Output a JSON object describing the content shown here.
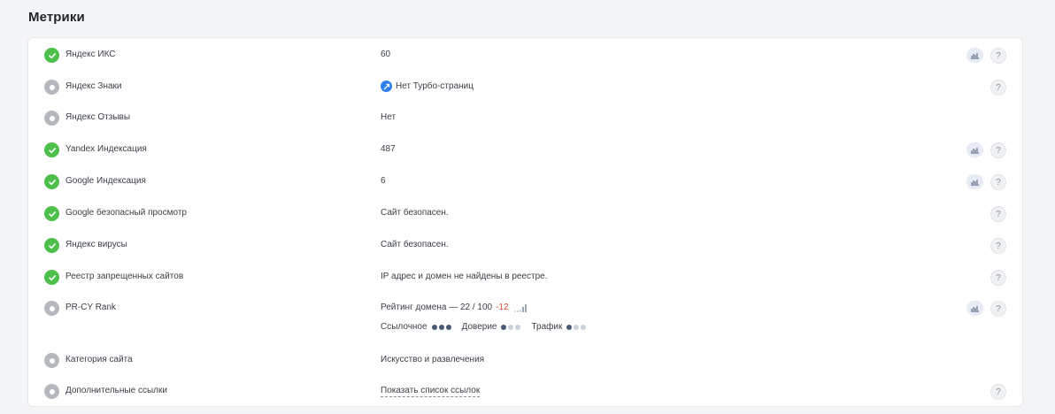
{
  "section_title": "Метрики",
  "rows": [
    {
      "label": "Яндекс ИКС",
      "value": "60"
    },
    {
      "label": "Яндекс Знаки",
      "value": "Нет Турбо-страниц"
    },
    {
      "label": "Яндекс Отзывы",
      "value": "Нет"
    },
    {
      "label": "Yandex Индексация",
      "value": "487"
    },
    {
      "label": "Google Индексация",
      "value": "6"
    },
    {
      "label": "Google безопасный просмотр",
      "value": "Сайт безопасен."
    },
    {
      "label": "Яндекс вирусы",
      "value": "Сайт безопасен."
    },
    {
      "label": "Реестр запрещенных сайтов",
      "value": "IP адрес и домен не найдены в реестре."
    },
    {
      "label": "PR-CY Rank",
      "value": "Рейтинг домена — 22 / 100",
      "delta": "-12"
    },
    {
      "label": "Категория сайта",
      "value": "Искусство и развлечения"
    },
    {
      "label": "Дополнительные ссылки",
      "value": "Показать список ссылок"
    }
  ],
  "prcy_sub": {
    "link_label": "Ссылочное",
    "link_level": 3,
    "trust_label": "Доверие",
    "trust_level": 1,
    "traffic_label": "Трафик",
    "traffic_level": 1
  },
  "help_symbol": "?",
  "colors": {
    "ok": "#4cc04a",
    "na": "#b5b8bd",
    "negative": "#e0473a",
    "turbo": "#2f80ed"
  }
}
